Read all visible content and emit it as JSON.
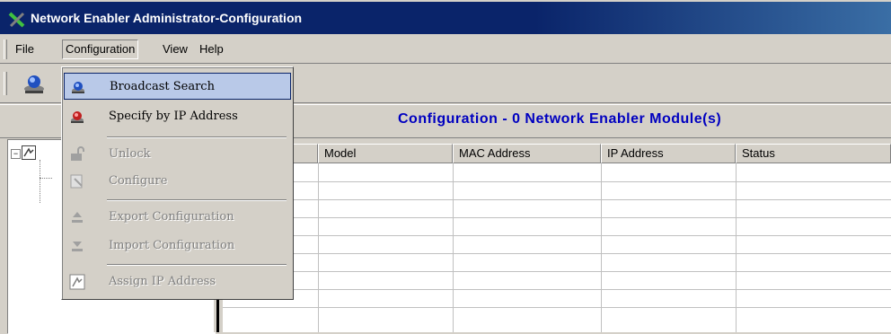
{
  "window": {
    "title": "Network Enabler Administrator-Configuration"
  },
  "menubar": {
    "items": [
      {
        "label": "File"
      },
      {
        "label": "Configuration"
      },
      {
        "label": "View"
      },
      {
        "label": "Help"
      }
    ]
  },
  "header": {
    "title": "Configuration - 0 Network Enabler Module(s)"
  },
  "grid": {
    "columns": [
      "Model",
      "MAC Address",
      "IP Address",
      "Status"
    ]
  },
  "dropdown": {
    "items": [
      {
        "label": "Broadcast Search",
        "enabled": true,
        "selected": true,
        "icon": "broadcast-search-icon"
      },
      {
        "label": "Specify by IP Address",
        "enabled": true,
        "selected": false,
        "icon": "specify-ip-icon"
      },
      {
        "label": "Unlock",
        "enabled": false,
        "selected": false,
        "icon": "unlock-icon"
      },
      {
        "label": "Configure",
        "enabled": false,
        "selected": false,
        "icon": "configure-icon"
      },
      {
        "label": "Export Configuration",
        "enabled": false,
        "selected": false,
        "icon": "export-icon"
      },
      {
        "label": "Import Configuration",
        "enabled": false,
        "selected": false,
        "icon": "import-icon"
      },
      {
        "label": "Assign IP Address",
        "enabled": false,
        "selected": false,
        "icon": "assign-ip-icon"
      }
    ]
  },
  "colors": {
    "title_bar": "#0a246a",
    "face": "#d4d0c8",
    "header_title": "#0000c0",
    "menu_highlight": "#b9c9e8"
  }
}
